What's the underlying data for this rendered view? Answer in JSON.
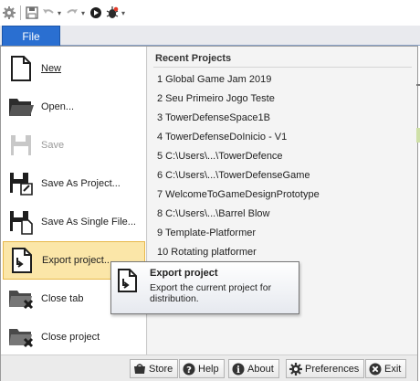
{
  "quick_access": {
    "icons": [
      "gear-icon",
      "save-icon",
      "undo-icon",
      "redo-icon",
      "play-icon",
      "debug-bug-icon"
    ]
  },
  "file_tab": {
    "label": "File"
  },
  "menu": {
    "items": [
      {
        "label": "New",
        "accel": "N",
        "icon": "new-file-icon",
        "enabled": true
      },
      {
        "label": "Open...",
        "accel": "O",
        "icon": "open-folder-icon",
        "enabled": true
      },
      {
        "label": "Save",
        "accel": "S",
        "icon": "save-icon",
        "enabled": false
      },
      {
        "label": "Save As Project...",
        "icon": "save-as-icon",
        "enabled": true
      },
      {
        "label": "Save As Single File...",
        "accel": "A",
        "icon": "save-single-file-icon",
        "enabled": true
      },
      {
        "label": "Export project...",
        "icon": "export-project-icon",
        "enabled": true,
        "highlighted": true
      },
      {
        "label": "Close tab",
        "accel": "t",
        "icon": "close-tab-icon",
        "enabled": true
      },
      {
        "label": "Close project",
        "accel": "C",
        "icon": "close-project-icon",
        "enabled": true
      }
    ]
  },
  "recent_projects": {
    "title": "Recent Projects",
    "items": [
      "1 Global Game Jam 2019",
      "2 Seu Primeiro Jogo Teste",
      "3 TowerDefenseSpace1B",
      "4 TowerDefenseDoInicio - V1",
      "5 C:\\Users\\...\\TowerDefence",
      "6 C:\\Users\\...\\TowerDefenseGame",
      "7 WelcomeToGameDesignPrototype",
      "8 C:\\Users\\...\\Barrel Blow",
      "9 Template-Platformer",
      "10 Rotating platformer"
    ]
  },
  "tooltip": {
    "title": "Export project",
    "description": "Export the current project for distribution."
  },
  "bottom_buttons": {
    "store": "Store",
    "help": "Help",
    "about": "About",
    "preferences": "Preferences",
    "exit": "Exit"
  }
}
